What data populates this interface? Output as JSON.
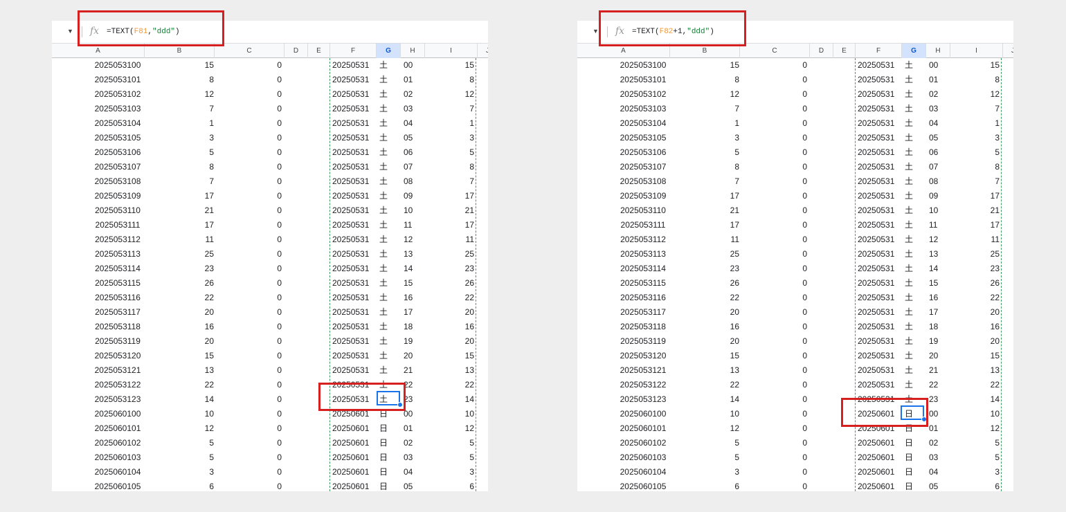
{
  "left": {
    "formula_prefix": "=TEXT(",
    "formula_ref": "F81",
    "formula_mid": ",",
    "formula_str": "\"ddd\"",
    "formula_suffix": ")"
  },
  "right": {
    "formula_prefix": "=TEXT(",
    "formula_ref": "F82",
    "formula_mid": "+1,",
    "formula_str": "\"ddd\"",
    "formula_suffix": ")"
  },
  "columns": [
    "A",
    "B",
    "C",
    "D",
    "E",
    "F",
    "G",
    "H",
    "I",
    "J"
  ],
  "fx_label": "fx",
  "rows": [
    [
      "2025053100",
      "15",
      "0",
      "20250531",
      "土",
      "00",
      "15"
    ],
    [
      "2025053101",
      "8",
      "0",
      "20250531",
      "土",
      "01",
      "8"
    ],
    [
      "2025053102",
      "12",
      "0",
      "20250531",
      "土",
      "02",
      "12"
    ],
    [
      "2025053103",
      "7",
      "0",
      "20250531",
      "土",
      "03",
      "7"
    ],
    [
      "2025053104",
      "1",
      "0",
      "20250531",
      "土",
      "04",
      "1"
    ],
    [
      "2025053105",
      "3",
      "0",
      "20250531",
      "土",
      "05",
      "3"
    ],
    [
      "2025053106",
      "5",
      "0",
      "20250531",
      "土",
      "06",
      "5"
    ],
    [
      "2025053107",
      "8",
      "0",
      "20250531",
      "土",
      "07",
      "8"
    ],
    [
      "2025053108",
      "7",
      "0",
      "20250531",
      "土",
      "08",
      "7"
    ],
    [
      "2025053109",
      "17",
      "0",
      "20250531",
      "土",
      "09",
      "17"
    ],
    [
      "2025053110",
      "21",
      "0",
      "20250531",
      "土",
      "10",
      "21"
    ],
    [
      "2025053111",
      "17",
      "0",
      "20250531",
      "土",
      "11",
      "17"
    ],
    [
      "2025053112",
      "11",
      "0",
      "20250531",
      "土",
      "12",
      "11"
    ],
    [
      "2025053113",
      "25",
      "0",
      "20250531",
      "土",
      "13",
      "25"
    ],
    [
      "2025053114",
      "23",
      "0",
      "20250531",
      "土",
      "14",
      "23"
    ],
    [
      "2025053115",
      "26",
      "0",
      "20250531",
      "土",
      "15",
      "26"
    ],
    [
      "2025053116",
      "22",
      "0",
      "20250531",
      "土",
      "16",
      "22"
    ],
    [
      "2025053117",
      "20",
      "0",
      "20250531",
      "土",
      "17",
      "20"
    ],
    [
      "2025053118",
      "16",
      "0",
      "20250531",
      "土",
      "18",
      "16"
    ],
    [
      "2025053119",
      "20",
      "0",
      "20250531",
      "土",
      "19",
      "20"
    ],
    [
      "2025053120",
      "15",
      "0",
      "20250531",
      "土",
      "20",
      "15"
    ],
    [
      "2025053121",
      "13",
      "0",
      "20250531",
      "土",
      "21",
      "13"
    ],
    [
      "2025053122",
      "22",
      "0",
      "20250531",
      "土",
      "22",
      "22"
    ],
    [
      "2025053123",
      "14",
      "0",
      "20250531",
      "土",
      "23",
      "14"
    ],
    [
      "2025060100",
      "10",
      "0",
      "20250601",
      "日",
      "00",
      "10"
    ],
    [
      "2025060101",
      "12",
      "0",
      "20250601",
      "日",
      "01",
      "12"
    ],
    [
      "2025060102",
      "5",
      "0",
      "20250601",
      "日",
      "02",
      "5"
    ],
    [
      "2025060103",
      "5",
      "0",
      "20250601",
      "日",
      "03",
      "5"
    ],
    [
      "2025060104",
      "3",
      "0",
      "20250601",
      "日",
      "04",
      "3"
    ],
    [
      "2025060105",
      "6",
      "0",
      "20250601",
      "日",
      "05",
      "6"
    ]
  ],
  "colors": {
    "highlight": "#d61f1f",
    "cursor": "#1a73e8",
    "dashed_border": "#3d9d5c",
    "selected_header": "#d3e3fd"
  }
}
